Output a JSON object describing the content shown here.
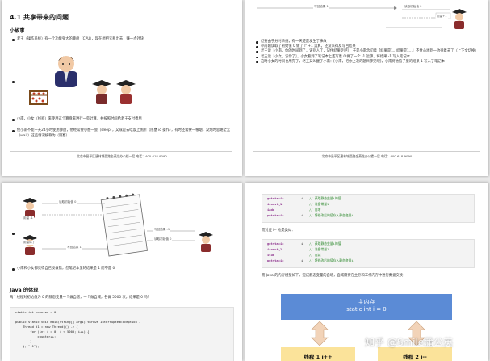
{
  "page1": {
    "title": "4.1 共享带来的问题",
    "subtitle": "小故事",
    "bullet1": "老王（操作系统）有一个功能强大的算盘（CPU），现在想把它租出去，赚一点外快",
    "bullet3a": "小南、小女（线程）来使用这个算盘来进行一些计算，并按照时间给老王支付费用",
    "bullet3b": "但小南不能一天24小时使用算盘，他经常要小憩一会（sleep），又或是去吃饭上厕所（阻塞 io 操作），有时还需要一根烟，没烟时思路全无（wait）这些情况统称为（阻塞）",
    "footer": "北京市昌平区建材城西路金燕龙办公楼一层    电话：400-618-9090"
  },
  "page2": {
    "diag_label_top": "写回结果 1",
    "diag_label_right": "读取初始值 0",
    "diag_label_side": "用量+1",
    "bullets": [
      "但要由于分时系统，有一天还是发生了事故",
      "小南刚读取了初始值 0 做了个 +1 运算，还没来得及写回结果",
      "老王说［小南，你的时间到了，该别人了，记住结果走吧］，于是小南念叨着［结果是1，结果是1...］不甘心地到一边待着去了（上下文切换）",
      "老王说［小女，该你了］，小女看到了笔记本上还写着 0 做了一个 -1 运算，将结果 -1 写入笔记本",
      "这时小女的时间也用完了，老王又叫醒了小南：[小南，把你上次的题目算完吧]，小南将他脑子里的结果 1 写入了笔记本"
    ],
    "footer": "北京市昌平区建材城西路金燕龙办公楼一层    电话：400-618-9090"
  },
  "page3": {
    "label_top": "读取初始值 0",
    "label_left": "用量 -1",
    "label_right": "写回结果 -1",
    "label_right2": "读取初始值 0",
    "label_bottom": "用量除了",
    "label_bottom2": "写回结果 1",
    "bullet": "小南和小女都觉得自己没做错，但笔记本里的结果是 1 而不是 0",
    "subtitle": "Java 的体现",
    "desc": "两个线程对初始值为 0 的静态变量一个做自增，一个做自减，各做 5000 次，结果是 0 吗？",
    "code": [
      "static int counter = 0;",
      "",
      "public static void main(String[] args) throws InterruptedException {",
      "    Thread t1 = new Thread(() -> {",
      "        for (int i = 0; i < 5000; i++) {",
      "            counter++;",
      "        }",
      "    }, \"t1\");"
    ]
  },
  "page4": {
    "code1": [
      {
        "op": "getstatic",
        "arg": "i",
        "comment": "// 获取静态变量i的值"
      },
      {
        "op": "iconst_1",
        "arg": "",
        "comment": "// 准备常量1"
      },
      {
        "op": "iadd",
        "arg": "",
        "comment": "// 自增"
      },
      {
        "op": "putstatic",
        "arg": "i",
        "comment": "// 将修改后的值存入静态变量i"
      }
    ],
    "mid_text": "而对应 i-- 也是类似：",
    "code2": [
      {
        "op": "getstatic",
        "arg": "i",
        "comment": "// 获取静态变量i的值"
      },
      {
        "op": "iconst_1",
        "arg": "",
        "comment": "// 准备常量1"
      },
      {
        "op": "isub",
        "arg": "",
        "comment": "// 自减"
      },
      {
        "op": "putstatic",
        "arg": "i",
        "comment": "// 将修改后的值存入静态变量i"
      }
    ],
    "bottom_text": "而 Java 的内存模型如下，完成静态变量的自增，自减需要在主存和工作内存中进行数据交换：",
    "mem_title_1": "主内存",
    "mem_title_2": "static int i = 0",
    "thread1": "线程 1  i++",
    "thread2": "线程 2  i--",
    "watermark": "知乎 @Smile蒲公英"
  },
  "colors": {
    "mem_blue": "#5b8bd6",
    "thread_yellow": "#fbe39a",
    "arrow_fill": "#f2d3b8"
  }
}
